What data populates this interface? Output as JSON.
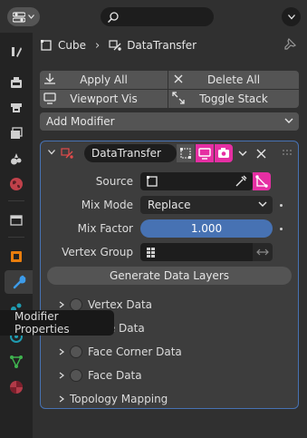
{
  "header": {
    "search_placeholder": ""
  },
  "breadcrumb": {
    "object": "Cube",
    "modifier": "DataTransfer"
  },
  "ops": {
    "apply_all": "Apply All",
    "delete_all": "Delete All",
    "viewport_vis": "Viewport Vis",
    "toggle_stack": "Toggle Stack"
  },
  "add_modifier": "Add Modifier",
  "modifier": {
    "name": "DataTransfer",
    "source_label": "Source",
    "source_value": "",
    "mix_mode_label": "Mix Mode",
    "mix_mode_value": "Replace",
    "mix_factor_label": "Mix Factor",
    "mix_factor_value": "1.000",
    "vertex_group_label": "Vertex Group",
    "vertex_group_value": "",
    "generate_label": "Generate Data Layers",
    "sections": [
      {
        "label": "Vertex Data"
      },
      {
        "label": "Edge Data"
      },
      {
        "label": "Face Corner Data"
      },
      {
        "label": "Face Data"
      },
      {
        "label": "Topology Mapping"
      }
    ]
  },
  "tooltip": "Modifier Properties",
  "colors": {
    "accent": "#4772b3",
    "mix_factor_fill": "#4772b3",
    "toggle_active": "#e52fa3",
    "panel_bg": "#303030",
    "tab_bg": "#232323"
  }
}
